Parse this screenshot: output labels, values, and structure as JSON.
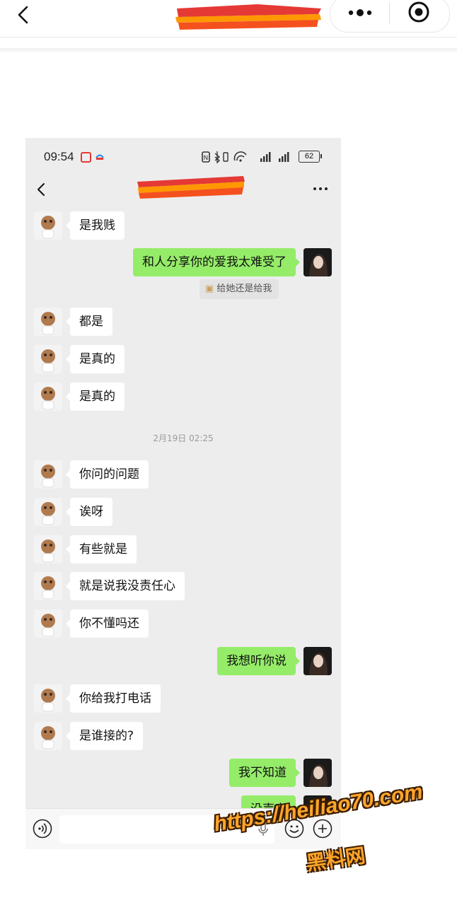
{
  "outer_header": {
    "back_icon": "chevron-left-icon",
    "title": "",
    "more_icon": "more-dots-icon",
    "target_icon": "target-circle-icon"
  },
  "status_bar": {
    "time": "09:54",
    "battery": "62"
  },
  "chat": {
    "title": "",
    "more_icon": "more-horizontal-icon",
    "messages": [
      {
        "side": "left",
        "text": "是我贱"
      },
      {
        "side": "right",
        "text": "和人分享你的爱我太难受了"
      },
      {
        "side": "quote",
        "text": "给她还是给我"
      },
      {
        "side": "left",
        "text": "都是"
      },
      {
        "side": "left",
        "text": "是真的"
      },
      {
        "side": "left",
        "text": "是真的"
      },
      {
        "side": "time",
        "text": "2月19日 02:25"
      },
      {
        "side": "left",
        "text": "你问的问题"
      },
      {
        "side": "left",
        "text": "诶呀"
      },
      {
        "side": "left",
        "text": "有些就是"
      },
      {
        "side": "left",
        "text": "就是说我没责任心"
      },
      {
        "side": "left",
        "text": "你不懂吗还"
      },
      {
        "side": "right",
        "text": "我想听你说"
      },
      {
        "side": "left",
        "text": "你给我打电话"
      },
      {
        "side": "left",
        "text": "是谁接的?"
      },
      {
        "side": "right",
        "text": "我不知道"
      },
      {
        "side": "right",
        "text": "没声音"
      }
    ]
  },
  "input_bar": {
    "voice_icon": "voice-icon",
    "value": "",
    "mic_icon": "mic-icon",
    "emoji_icon": "emoji-icon",
    "plus_icon": "plus-icon"
  },
  "watermark": {
    "url": "https://heiliao70.com",
    "name": "黑料网"
  },
  "colors": {
    "chat_background": "#ededed",
    "bubble_right": "#95ec69",
    "bubble_left": "#ffffff",
    "watermark": "#ffa52b"
  }
}
